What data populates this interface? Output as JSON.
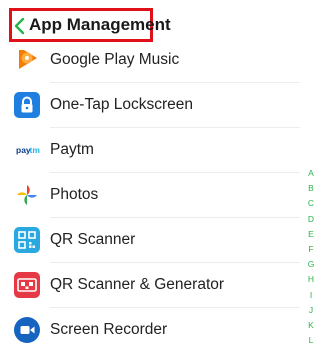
{
  "header": {
    "title": "App Management",
    "back_icon": "chevron-left-icon",
    "highlight_color": "#e0101a",
    "accent_color": "#29b44a"
  },
  "apps": [
    {
      "label": "Google Play Music",
      "icon": "google-play-music-icon"
    },
    {
      "label": "One-Tap Lockscreen",
      "icon": "lock-icon"
    },
    {
      "label": "Paytm",
      "icon": "paytm-icon"
    },
    {
      "label": "Photos",
      "icon": "photos-pinwheel-icon"
    },
    {
      "label": "QR Scanner",
      "icon": "qr-code-icon"
    },
    {
      "label": "QR Scanner & Generator",
      "icon": "qr-scanner-generator-icon"
    },
    {
      "label": "Screen Recorder",
      "icon": "video-camera-icon"
    }
  ],
  "alphabet_index": [
    "A",
    "B",
    "C",
    "D",
    "E",
    "F",
    "G",
    "H",
    "I",
    "J",
    "K",
    "L"
  ]
}
